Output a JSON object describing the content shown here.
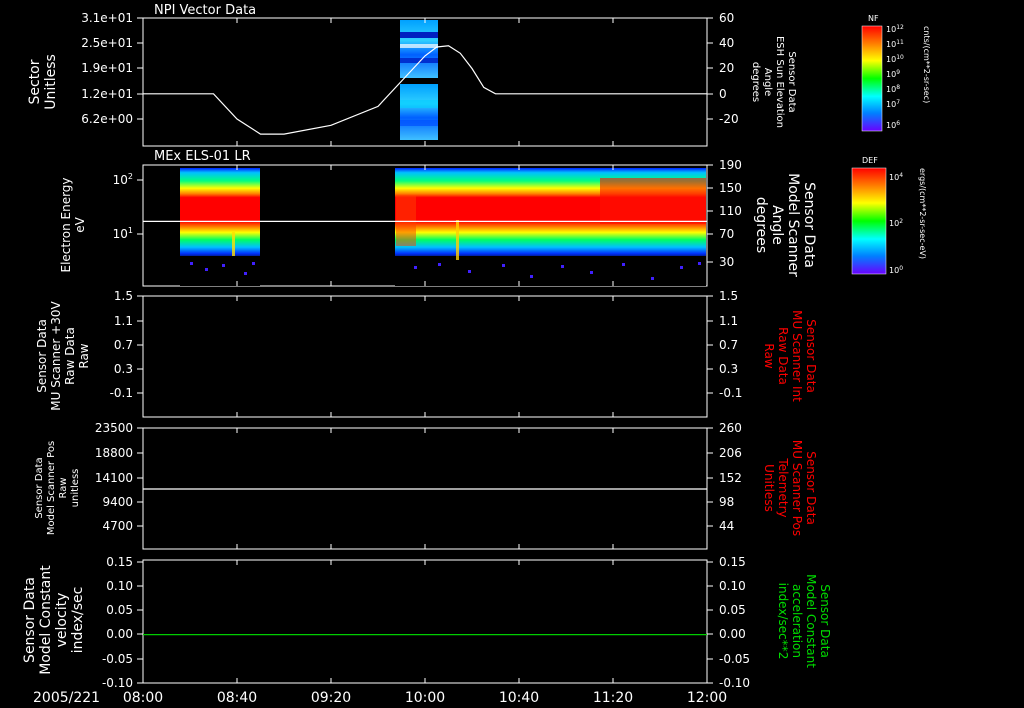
{
  "panels": [
    {
      "id": "npi",
      "title": "NPI Vector Data",
      "left_label": [
        "Sector",
        "Unitless"
      ],
      "left_ticks": [
        "3.1e+01",
        "2.5e+01",
        "1.9e+01",
        "1.2e+01",
        "6.2e+00"
      ],
      "right_label": [
        "Sensor Data",
        "ESH Sun Elevation",
        "Angle",
        "degrees"
      ],
      "right_ticks": [
        "60",
        "40",
        "20",
        "0",
        "-20"
      ]
    },
    {
      "id": "els",
      "title": "MEx ELS-01 LR",
      "left_label": [
        "Electron Energy",
        "eV"
      ],
      "left_ticks": [
        "10",
        "10"
      ],
      "left_tick_exps": [
        "2",
        "1"
      ],
      "right_label": [
        "Sensor Data",
        "Model Scanner",
        "Angle",
        "degrees"
      ],
      "right_ticks": [
        "190",
        "150",
        "110",
        "70",
        "30"
      ]
    },
    {
      "id": "mu_raw",
      "left_label": [
        "Sensor Data",
        "MU Scanner +30V",
        "Raw Data",
        "Raw"
      ],
      "left_ticks": [
        "1.5",
        "1.1",
        "0.7",
        "0.3",
        "-0.1"
      ],
      "right_label": [
        "Sensor Data",
        "MU Scanner Int",
        "Raw Data",
        "Raw"
      ],
      "right_ticks": [
        "1.5",
        "1.1",
        "0.7",
        "0.3",
        "-0.1"
      ]
    },
    {
      "id": "scanner_pos",
      "left_label": [
        "Sensor Data",
        "Model Scanner Pos",
        "Raw",
        "unitless"
      ],
      "left_ticks": [
        "23500",
        "18800",
        "14100",
        "9400",
        "4700"
      ],
      "right_label": [
        "Sensor Data",
        "MU Scanner Pos",
        "Telemetry",
        "Unitless"
      ],
      "right_ticks": [
        "260",
        "206",
        "152",
        "98",
        "44"
      ]
    },
    {
      "id": "model_const",
      "left_label": [
        "Sensor Data",
        "Model Constant",
        "velocity",
        "index/sec"
      ],
      "left_ticks": [
        "0.15",
        "0.10",
        "0.05",
        "0.00",
        "-0.05",
        "-0.10"
      ],
      "right_label": [
        "Sensor Data",
        "Model Constant",
        "acceleration",
        "index/sec**2"
      ],
      "right_ticks": [
        "0.15",
        "0.10",
        "0.05",
        "0.00",
        "-0.05",
        "-0.10"
      ]
    }
  ],
  "colorbars": [
    {
      "title": "NF",
      "unit": "cnts/(cm**2-sr-sec)",
      "ticks": [
        "10",
        "10",
        "10",
        "10",
        "10",
        "10",
        "10"
      ],
      "tick_exps": [
        "12",
        "11",
        "10",
        "9",
        "8",
        "7",
        "6"
      ]
    },
    {
      "title": "DEF",
      "unit": "ergs/(cm**2-sr-sec-eV)",
      "ticks": [
        "10",
        "10",
        "10"
      ],
      "tick_exps": [
        "4",
        "2",
        "0"
      ]
    }
  ],
  "time_axis": {
    "date": "2005/221",
    "labels": [
      "08:00",
      "08:40",
      "09:20",
      "10:00",
      "10:40",
      "11:20",
      "12:00"
    ]
  },
  "colors": {
    "background": "#000000",
    "axes": "#ffffff",
    "right_label_red": "#ff0000",
    "right_label_green": "#00dd00",
    "const_line": "#00cc00"
  },
  "chart_data": [
    {
      "type": "line",
      "title": "NPI Vector Data",
      "x_range": [
        "08:00",
        "12:00"
      ],
      "series": [
        {
          "x": [
            "08:00",
            "08:30",
            "08:40",
            "08:50",
            "09:00",
            "09:20",
            "09:40",
            "09:50",
            "10:00",
            "10:05",
            "10:10",
            "10:15",
            "10:20",
            "10:25",
            "10:30",
            "12:00"
          ],
          "values": [
            0,
            0,
            -20,
            -32,
            -32,
            -25,
            -10,
            10,
            30,
            37,
            38,
            32,
            20,
            5,
            0,
            0
          ]
        }
      ],
      "ylim": [
        -40,
        60
      ],
      "spectrogram_segments": [
        {
          "start": "09:50",
          "end": "10:05",
          "colorbar": "NF"
        }
      ]
    },
    {
      "type": "heatmap",
      "title": "MEx ELS-01 LR",
      "ylabel": "Electron Energy eV",
      "y_scale": "log",
      "data_segments": [
        {
          "start": "08:15",
          "end": "08:45"
        },
        {
          "start": "09:50",
          "end": "12:00"
        }
      ],
      "overlay_line": {
        "label": "Model Scanner Angle",
        "value": 97
      },
      "ylim_right": [
        10,
        190
      ]
    },
    {
      "type": "line",
      "series": [],
      "ylim": [
        -0.3,
        1.5
      ]
    },
    {
      "type": "line",
      "series": [
        {
          "x": [
            "08:00",
            "12:00"
          ],
          "values": [
            11800,
            11800
          ]
        }
      ],
      "ylim": [
        0,
        23500
      ]
    },
    {
      "type": "line",
      "series": [
        {
          "x": [
            "08:00",
            "12:00"
          ],
          "values": [
            0,
            0
          ]
        }
      ],
      "ylim": [
        -0.1,
        0.15
      ]
    }
  ]
}
